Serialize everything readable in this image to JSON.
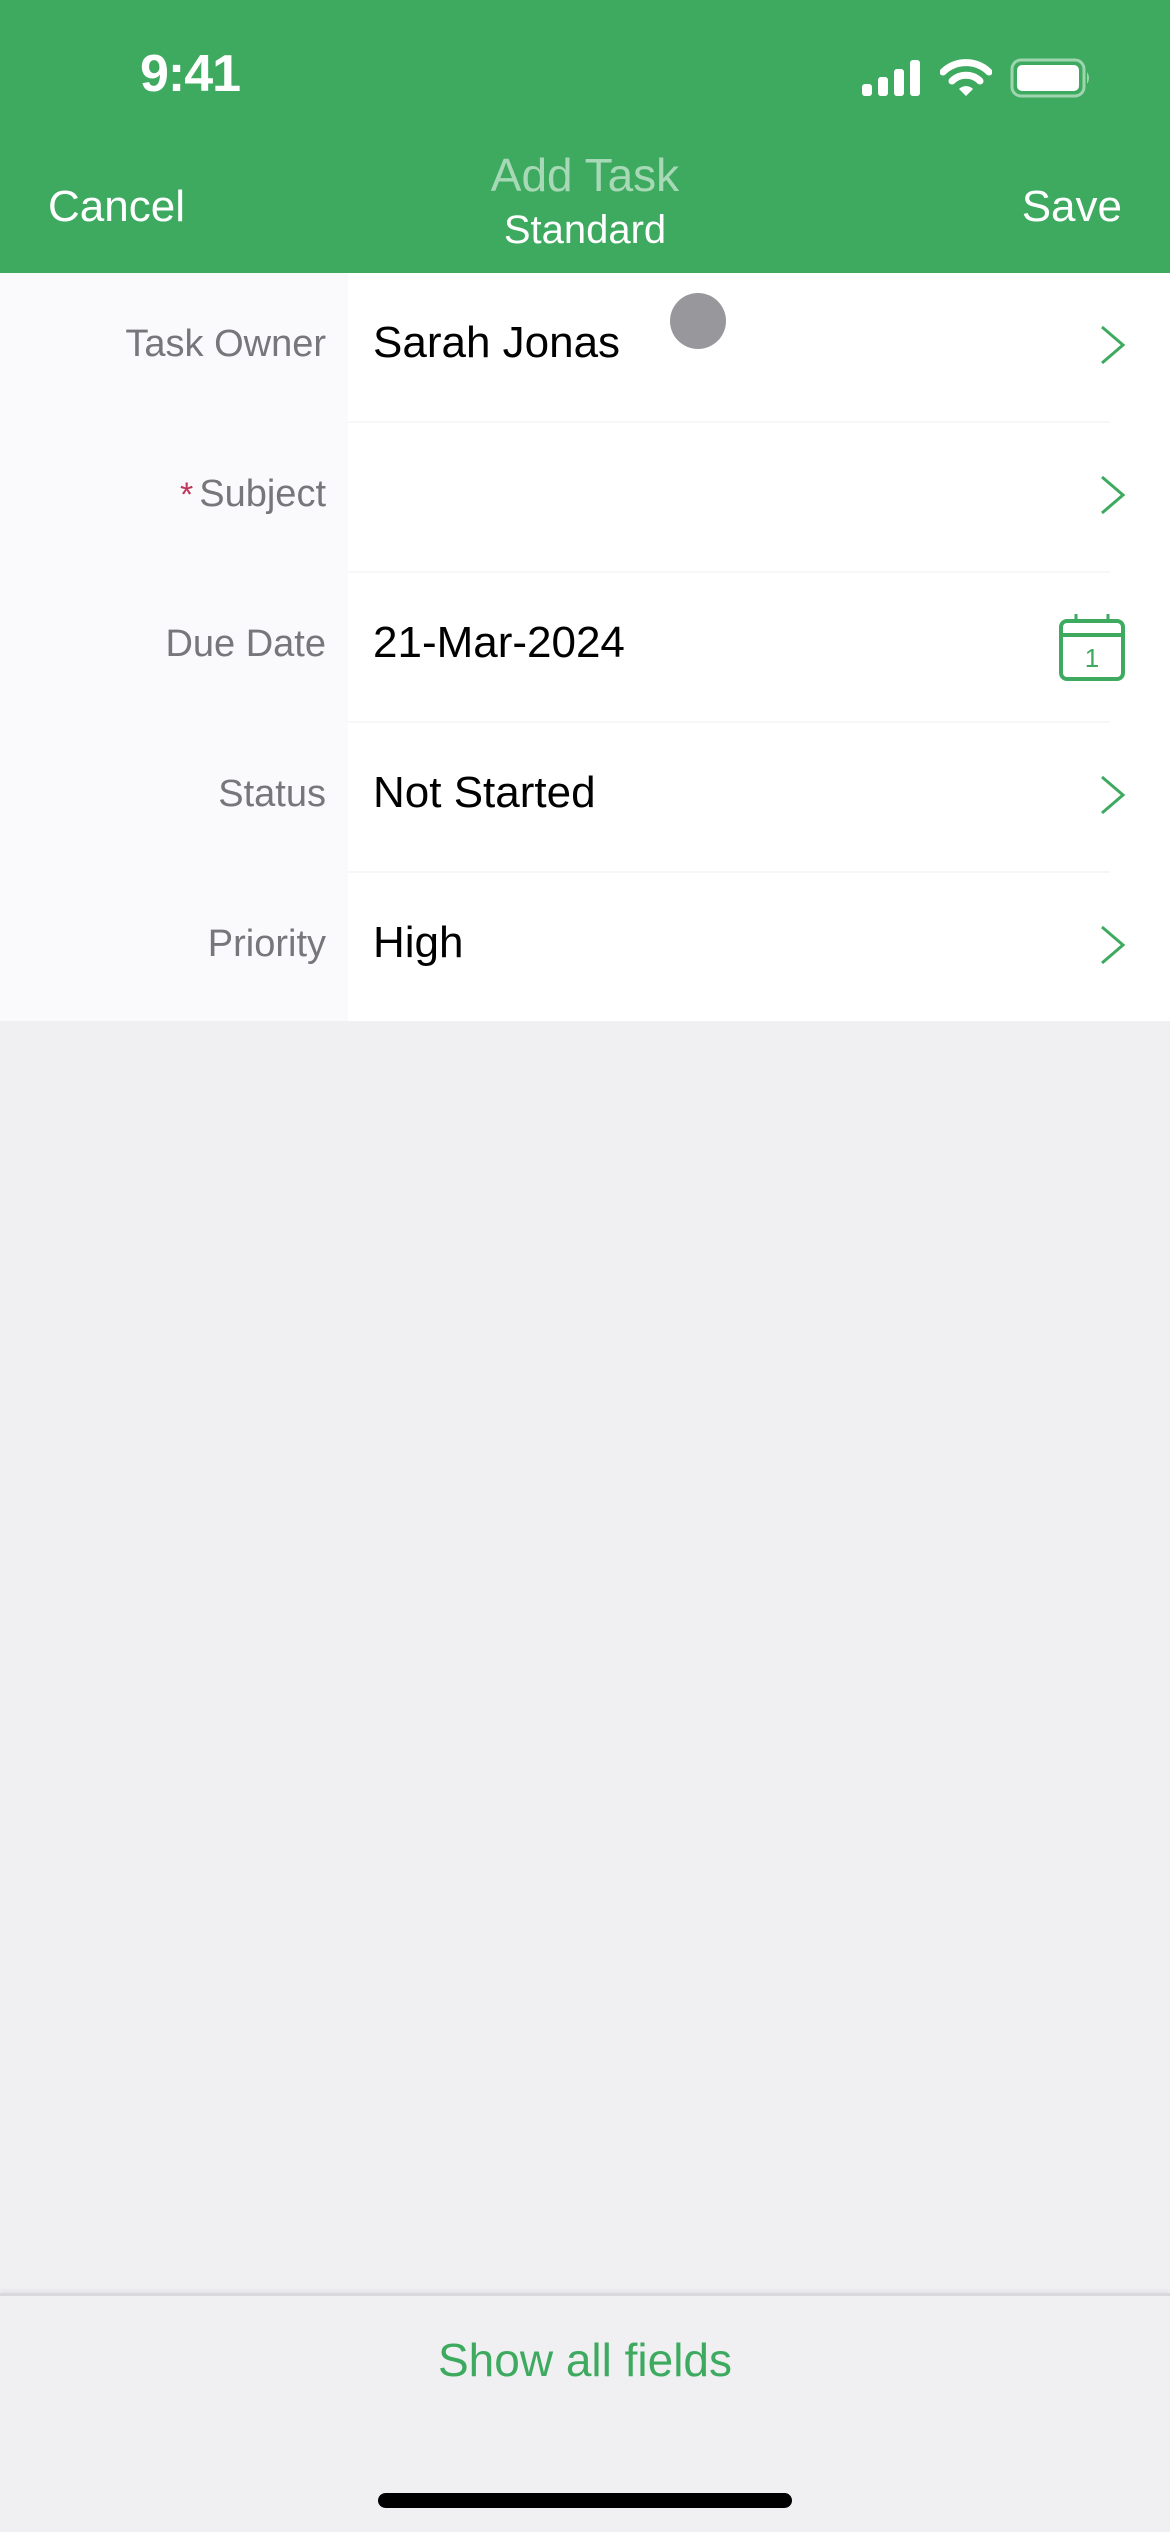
{
  "status_bar": {
    "time": "9:41",
    "icons": [
      "cellular-signal-icon",
      "wifi-icon",
      "battery-icon"
    ]
  },
  "nav": {
    "cancel_label": "Cancel",
    "title": "Add Task",
    "subtitle": "Standard",
    "save_label": "Save"
  },
  "colors": {
    "brand": "#3daa5f",
    "required": "#c0355a",
    "label": "#76767b",
    "background": "#f0eff2"
  },
  "form": {
    "fields": [
      {
        "label": "Task Owner",
        "value": "Sarah Jonas",
        "required": false,
        "accessory": "chevron-right-icon"
      },
      {
        "label": "Subject",
        "value": "",
        "required": true,
        "required_marker": "*",
        "accessory": "chevron-right-icon"
      },
      {
        "label": "Due Date",
        "value": "21-Mar-2024",
        "required": false,
        "accessory": "calendar-icon",
        "accessory_text": "1"
      },
      {
        "label": "Status",
        "value": "Not Started",
        "required": false,
        "accessory": "chevron-right-icon"
      },
      {
        "label": "Priority",
        "value": "High",
        "required": false,
        "accessory": "chevron-right-icon"
      }
    ]
  },
  "footer": {
    "show_all_label": "Show all fields"
  }
}
